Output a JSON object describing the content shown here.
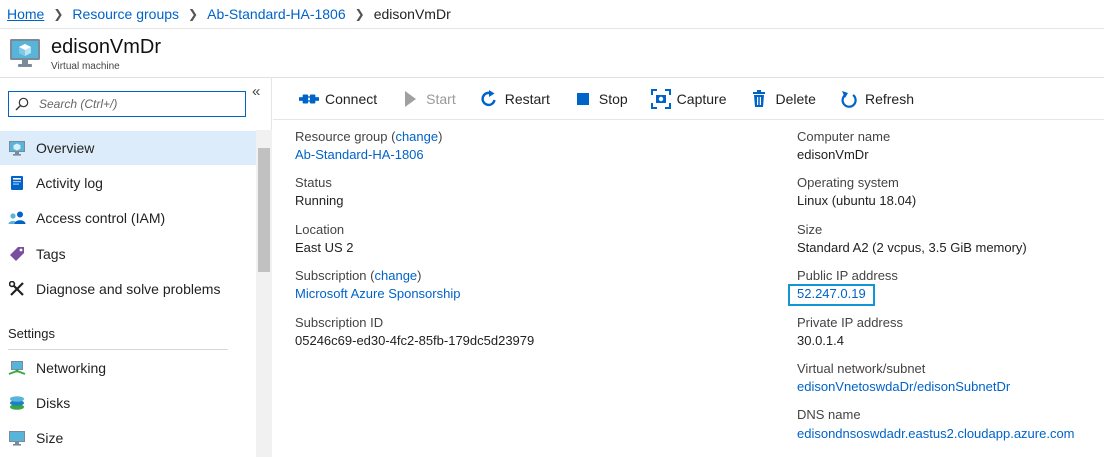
{
  "breadcrumb": [
    "Home",
    "Resource groups",
    "Ab-Standard-HA-1806",
    "edisonVmDr"
  ],
  "header": {
    "title": "edisonVmDr",
    "subtitle": "Virtual machine",
    "icon": "virtual-machine-icon"
  },
  "sidebar": {
    "search_placeholder": "Search (Ctrl+/)",
    "collapse": "«",
    "items": [
      {
        "label": "Overview",
        "icon": "overview-icon",
        "active": true
      },
      {
        "label": "Activity log",
        "icon": "activity-log-icon"
      },
      {
        "label": "Access control (IAM)",
        "icon": "access-control-icon"
      },
      {
        "label": "Tags",
        "icon": "tag-icon"
      },
      {
        "label": "Diagnose and solve problems",
        "icon": "wrench-icon"
      }
    ],
    "section": "Settings",
    "settings_items": [
      {
        "label": "Networking",
        "icon": "networking-icon"
      },
      {
        "label": "Disks",
        "icon": "disks-icon"
      },
      {
        "label": "Size",
        "icon": "size-icon"
      }
    ]
  },
  "toolbar": {
    "connect": "Connect",
    "start": "Start",
    "restart": "Restart",
    "stop": "Stop",
    "capture": "Capture",
    "delete": "Delete",
    "refresh": "Refresh"
  },
  "essentials": {
    "resource_group_label": "Resource group",
    "change": "change",
    "resource_group": "Ab-Standard-HA-1806",
    "status_label": "Status",
    "status": "Running",
    "location_label": "Location",
    "location": "East US 2",
    "subscription_label": "Subscription",
    "subscription": "Microsoft Azure Sponsorship",
    "subscription_id_label": "Subscription ID",
    "subscription_id": "05246c69-ed30-4fc2-85fb-179dc5d23979",
    "computer_name_label": "Computer name",
    "computer_name": "edisonVmDr",
    "os_label": "Operating system",
    "os": "Linux (ubuntu 18.04)",
    "size_label": "Size",
    "size": "Standard A2 (2 vcpus, 3.5 GiB memory)",
    "public_ip_label": "Public IP address",
    "public_ip": "52.247.0.19",
    "private_ip_label": "Private IP address",
    "private_ip": "30.0.1.4",
    "vnet_label": "Virtual network/subnet",
    "vnet": "edisonVnetoswdaDr/edisonSubnetDr",
    "dns_label": "DNS name",
    "dns": "edisondnsoswdadr.eastus2.cloudapp.azure.com"
  }
}
